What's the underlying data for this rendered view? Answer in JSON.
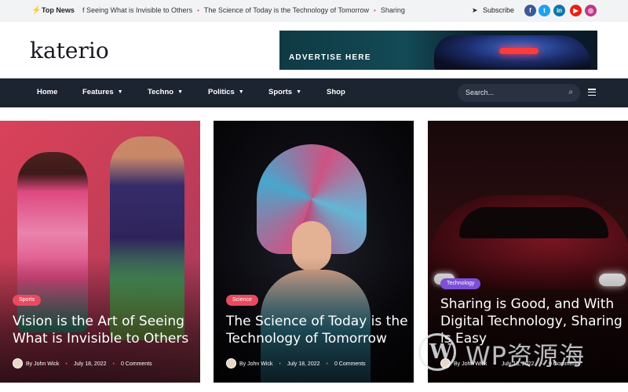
{
  "topbar": {
    "label": "Top News",
    "ticker": [
      "f Seeing What is Invisible to Others",
      "The Science of Today is the Technology of Tomorrow",
      "Sharing"
    ],
    "subscribe": "Subscribe",
    "social": [
      {
        "icon": "facebook-icon",
        "glyph": "f",
        "color": "#3b5998"
      },
      {
        "icon": "twitter-icon",
        "glyph": "t",
        "color": "#1da1f2"
      },
      {
        "icon": "linkedin-icon",
        "glyph": "in",
        "color": "#0e76a8"
      },
      {
        "icon": "youtube-icon",
        "glyph": "▶",
        "color": "#e62117"
      },
      {
        "icon": "instagram-icon",
        "glyph": "◎",
        "color": "#c13584"
      }
    ]
  },
  "header": {
    "logo": "katerio",
    "ad_text": "ADVERTISE HERE"
  },
  "nav": {
    "items": [
      {
        "label": "Home",
        "dropdown": false
      },
      {
        "label": "Features",
        "dropdown": true
      },
      {
        "label": "Techno",
        "dropdown": true
      },
      {
        "label": "Politics",
        "dropdown": true
      },
      {
        "label": "Sports",
        "dropdown": true
      },
      {
        "label": "Shop",
        "dropdown": false
      }
    ],
    "search_placeholder": "Search..."
  },
  "posts": [
    {
      "category": "Sports",
      "category_color": "#e84a5f",
      "title": "Vision is the Art of Seeing What is Invisible to Others",
      "author": "By John Wick",
      "date": "July 18, 2022",
      "comments": "0 Comments"
    },
    {
      "category": "Science",
      "category_color": "#e84a5f",
      "title": "The Science of Today is the Technology of Tomorrow",
      "author": "By John Wick",
      "date": "July 18, 2022",
      "comments": "0 Comments"
    },
    {
      "category": "Technology",
      "category_color": "#7d4fd8",
      "title": "Sharing is Good, and With Digital Technology, Sharing is Easy",
      "author": "By John Wick",
      "date": "July 13, 2022",
      "comments": "0 Comments"
    }
  ],
  "watermark": {
    "text": "WP资源海",
    "logo_letter": "W"
  },
  "colors": {
    "accent": "#e84a5f",
    "nav_bg": "#1c2331",
    "topbar_bg": "#f2f3f5"
  }
}
